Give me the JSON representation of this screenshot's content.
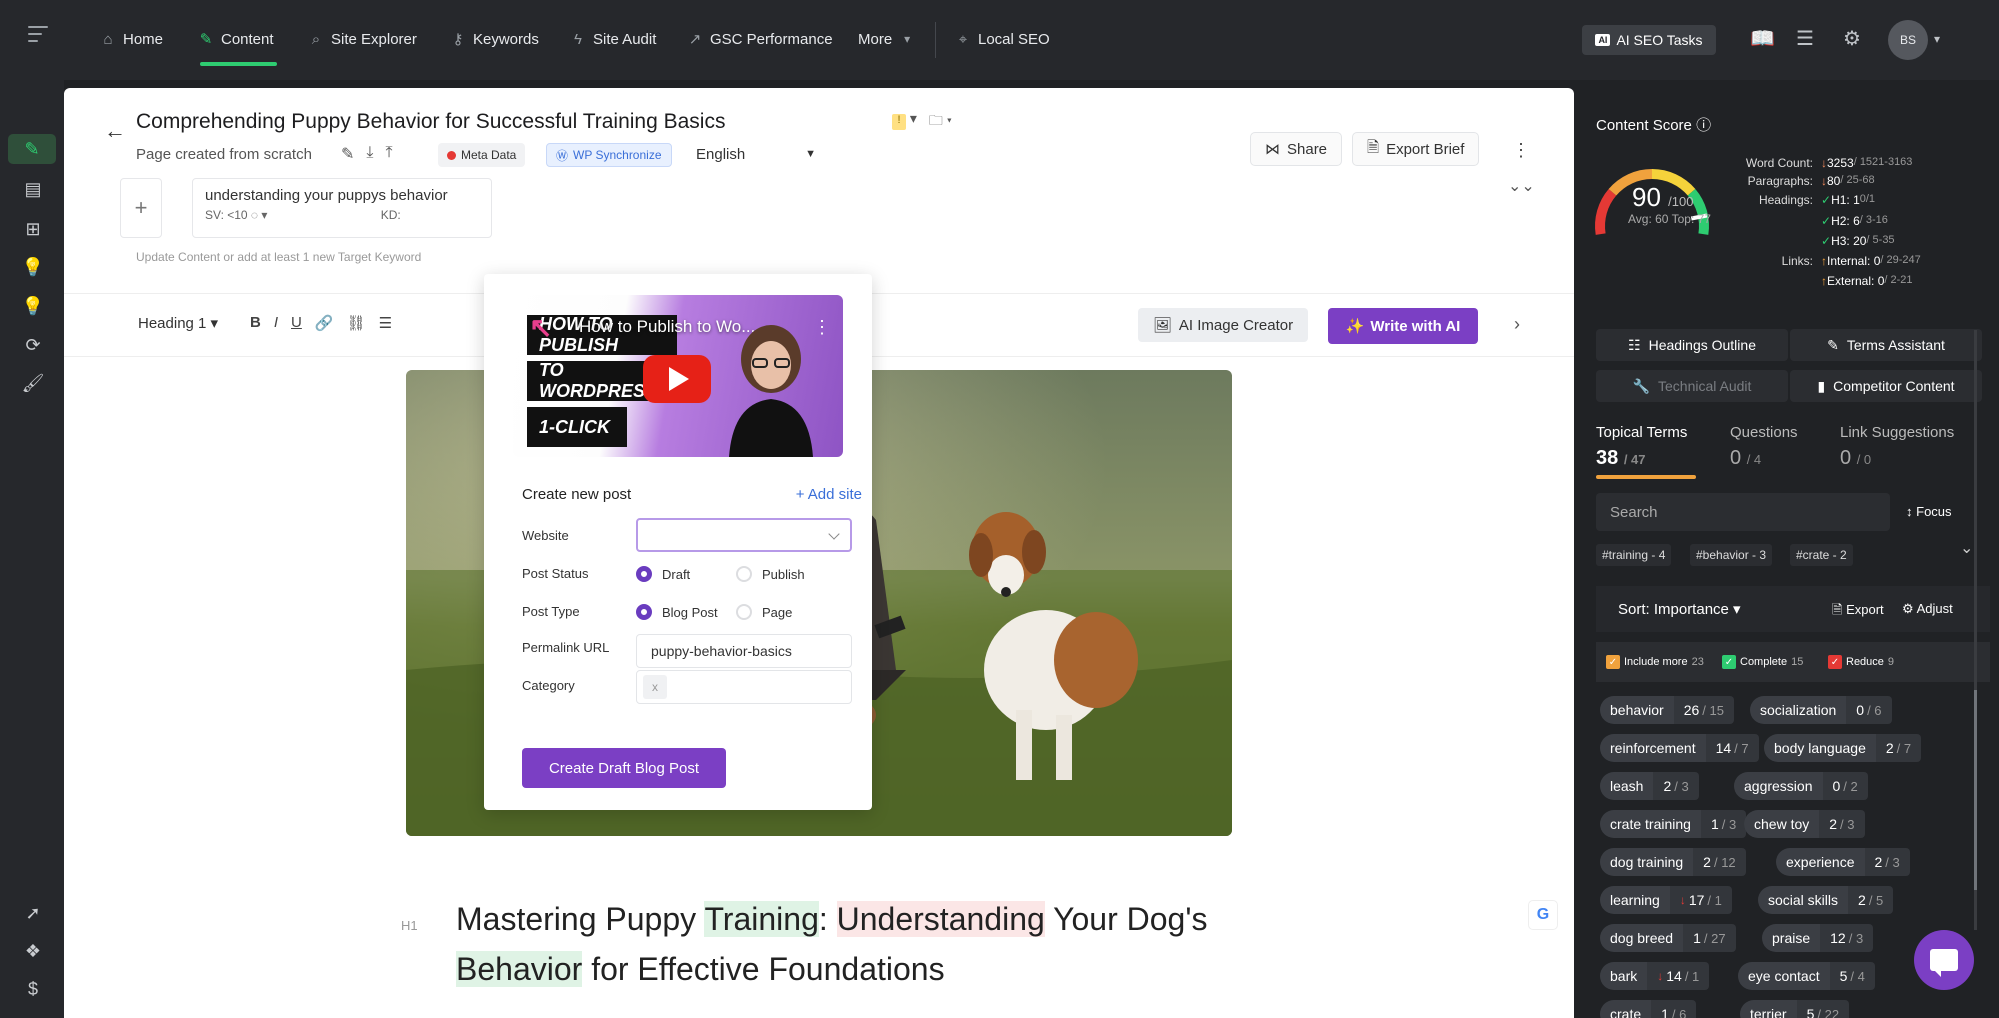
{
  "nav": {
    "items": [
      {
        "label": "Home",
        "icon": "home-icon",
        "glyph": "⌂"
      },
      {
        "label": "Content",
        "icon": "pencil-icon",
        "glyph": "✎"
      },
      {
        "label": "Site Explorer",
        "icon": "magnifier-icon",
        "glyph": "⌕"
      },
      {
        "label": "Keywords",
        "icon": "key-icon",
        "glyph": "⚷"
      },
      {
        "label": "Site Audit",
        "icon": "bolt-icon",
        "glyph": "ϟ"
      },
      {
        "label": "GSC Performance",
        "icon": "chart-line-icon",
        "glyph": "↗"
      },
      {
        "label": "More",
        "icon": "chevron-down-icon",
        "glyph": "▾"
      },
      {
        "label": "Local SEO",
        "icon": "location-pin-icon",
        "glyph": "⌖"
      }
    ],
    "ai_tasks_label": "AI SEO Tasks",
    "ai_badge": "AI",
    "avatar_initials": "BS"
  },
  "document": {
    "title": "Comprehending Puppy Behavior for Successful Training Basics",
    "subtitle": "Page created from scratch",
    "meta_data_label": "Meta Data",
    "wp_sync_label": "WP Synchronize",
    "language": "English",
    "share_label": "Share",
    "export_brief_label": "Export Brief",
    "warn_glyph": "!"
  },
  "keyword": {
    "text": "understanding your puppys behavior",
    "sv": "SV: <10",
    "kd": "KD:",
    "note": "Update Content or add at least 1 new Target Keyword"
  },
  "toolbar": {
    "heading_select": "Heading 1",
    "ai_image_label": "AI Image Creator",
    "write_ai_label": "Write with AI"
  },
  "body": {
    "h1_tag": "H1",
    "h1_parts": [
      "Mastering Puppy ",
      "Training",
      ": ",
      "Understanding",
      " Your Dog's ",
      "Behavior",
      " for Effective Foundations"
    ]
  },
  "wp_popup": {
    "video_title": "How to Publish to Wo...",
    "video_slabs": [
      "HOW TO PUBLISH",
      "TO WORDPRESS",
      "1-CLICK"
    ],
    "header": "Create new post",
    "add_site": "+ Add site",
    "website_label": "Website",
    "post_status_label": "Post Status",
    "status_options": [
      "Draft",
      "Publish"
    ],
    "post_type_label": "Post Type",
    "type_options": [
      "Blog Post",
      "Page"
    ],
    "permalink_label": "Permalink URL",
    "permalink_value": "puppy-behavior-basics",
    "category_label": "Category",
    "category_clear": "x",
    "create_button": "Create Draft Blog Post"
  },
  "content_score": {
    "title": "Content Score",
    "score": "90",
    "max": "/100",
    "avg_top": "Avg: 60 Top: 77",
    "progress": 0.9,
    "gauge_colors": [
      "#e53935",
      "#f0a23d",
      "#f5d33b",
      "#2ecc71"
    ],
    "stats": [
      {
        "label": "Word Count:",
        "trend": "↓",
        "trend_class": "down",
        "value": "3253",
        "range": " / 1521-3163"
      },
      {
        "label": "Paragraphs:",
        "trend": "↓",
        "trend_class": "down",
        "value": "80",
        "range": " / 25-68"
      },
      {
        "label": "Headings:",
        "trend": "✓",
        "trend_class": "ok",
        "value": "H1: 1",
        "range": " 0/1"
      },
      {
        "label": "",
        "trend": "✓",
        "trend_class": "ok",
        "value": "H2: 6",
        "range": " / 3-16"
      },
      {
        "label": "",
        "trend": "✓",
        "trend_class": "ok",
        "value": "H3: 20",
        "range": " / 5-35"
      },
      {
        "label": "Links:",
        "trend": "↑",
        "trend_class": "up",
        "value": "Internal: 0",
        "range": " / 29-247"
      },
      {
        "label": "",
        "trend": "↑",
        "trend_class": "up",
        "value": "External: 0",
        "range": " / 2-21"
      }
    ]
  },
  "panel": {
    "buttons": [
      "Headings Outline",
      "Terms Assistant",
      "Technical Audit",
      "Competitor Content"
    ],
    "tabs": [
      {
        "label": "Topical Terms",
        "count": "38",
        "total": "/ 47"
      },
      {
        "label": "Questions",
        "count": "0",
        "total": "/ 4"
      },
      {
        "label": "Link Suggestions",
        "count": "0",
        "total": "/ 0"
      }
    ],
    "search_placeholder": "Search",
    "focus_label": "Focus",
    "tags": [
      "#training - 4",
      "#behavior - 3",
      "#crate - 2"
    ],
    "sort_label": "Sort: Importance",
    "export_label": "Export",
    "adjust_label": "Adjust",
    "legend": [
      {
        "label": "Include more",
        "count": "23",
        "color": "#f0a23d",
        "glyph": "✓"
      },
      {
        "label": "Complete",
        "count": "15",
        "color": "#2ecc71",
        "glyph": "✓"
      },
      {
        "label": "Reduce",
        "count": "9",
        "color": "#e53935",
        "glyph": "✓"
      }
    ],
    "terms": [
      {
        "name": "behavior",
        "count": "26",
        "target": "/ 15",
        "reduce": false
      },
      {
        "name": "socialization",
        "count": "0",
        "target": "/ 6",
        "reduce": false
      },
      {
        "name": "reinforcement",
        "count": "14",
        "target": "/ 7",
        "reduce": false
      },
      {
        "name": "body language",
        "count": "2",
        "target": "/ 7",
        "reduce": false
      },
      {
        "name": "leash",
        "count": "2",
        "target": "/ 3",
        "reduce": false
      },
      {
        "name": "aggression",
        "count": "0",
        "target": "/ 2",
        "reduce": false
      },
      {
        "name": "crate training",
        "count": "1",
        "target": "/ 3",
        "reduce": false
      },
      {
        "name": "chew toy",
        "count": "2",
        "target": "/ 3",
        "reduce": false
      },
      {
        "name": "dog training",
        "count": "2",
        "target": "/ 12",
        "reduce": false
      },
      {
        "name": "experience",
        "count": "2",
        "target": "/ 3",
        "reduce": false
      },
      {
        "name": "learning",
        "count": "17",
        "target": "/ 1",
        "reduce": true
      },
      {
        "name": "social skills",
        "count": "2",
        "target": "/ 5",
        "reduce": false
      },
      {
        "name": "dog breed",
        "count": "1",
        "target": "/ 27",
        "reduce": false
      },
      {
        "name": "praise",
        "count": "12",
        "target": "/ 3",
        "reduce": false
      },
      {
        "name": "bark",
        "count": "14",
        "target": "/ 1",
        "reduce": true
      },
      {
        "name": "eye contact",
        "count": "5",
        "target": "/ 4",
        "reduce": false
      },
      {
        "name": "crate",
        "count": "1",
        "target": "/ 6",
        "reduce": false
      },
      {
        "name": "terrier",
        "count": "5",
        "target": "/ 22",
        "reduce": false
      }
    ]
  }
}
